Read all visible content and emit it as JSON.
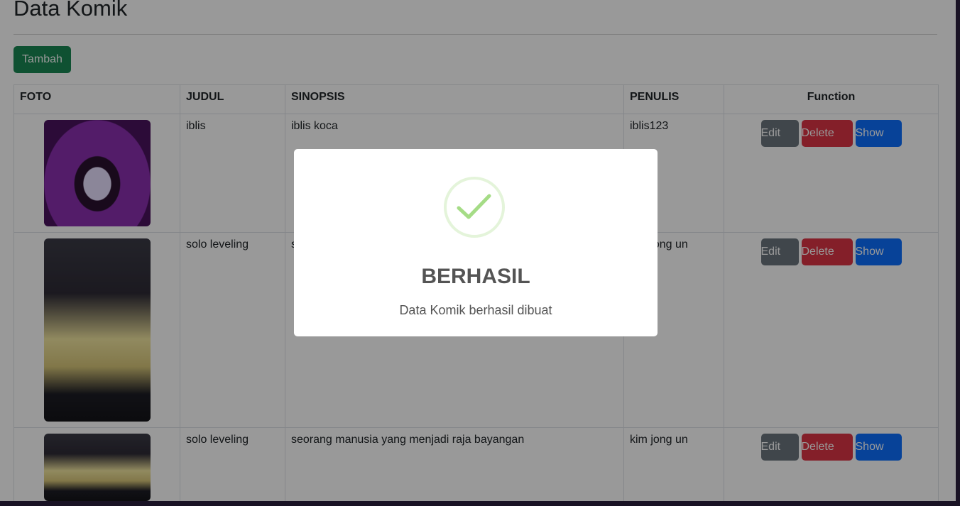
{
  "page": {
    "title": "Data Komik",
    "add_button": "Tambah"
  },
  "table": {
    "headers": [
      "FOTO",
      "JUDUL",
      "SINOPSIS",
      "PENULIS",
      "Function"
    ],
    "rows": [
      {
        "judul": "iblis",
        "sinopsis": "iblis koca",
        "penulis": "iblis123",
        "cover": "purple-grinning-demon-cover"
      },
      {
        "judul": "solo leveling",
        "sinopsis": "s",
        "penulis": "kim jong un",
        "cover": "hooded-hunter-cover"
      },
      {
        "judul": "solo leveling",
        "sinopsis": "seorang manusia yang menjadi raja bayangan",
        "penulis": "kim jong un",
        "cover": "hooded-hunter-cover"
      }
    ],
    "actions": {
      "edit": "Edit",
      "delete": "Delete",
      "show": "Show"
    }
  },
  "modal": {
    "icon": "check-icon",
    "title": "BERHASIL",
    "text": "Data Komik berhasil dibuat"
  },
  "colors": {
    "add": "#198754",
    "edit": "#6c757d",
    "delete": "#dc3545",
    "show": "#0d6efd",
    "success": "#a5dc86"
  }
}
